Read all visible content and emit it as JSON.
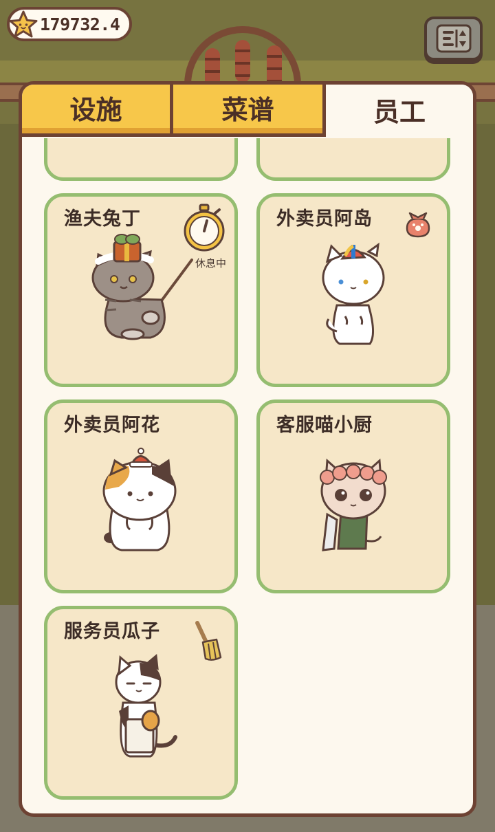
{
  "currency": {
    "value": "179732.4",
    "icon": "star-icon"
  },
  "settings": {
    "icon": "settings-sliders-icon"
  },
  "tabs": [
    {
      "label": "设施",
      "active": false
    },
    {
      "label": "菜谱",
      "active": false
    },
    {
      "label": "员工",
      "active": true
    }
  ],
  "staff": [
    {
      "name": "渔夫兔丁",
      "status": "休息中",
      "status_icon": "stopwatch-icon",
      "character": "tabby-cat-fisher"
    },
    {
      "name": "外卖员阿岛",
      "status_icon": "delivery-bag-icon",
      "character": "white-cat-propeller-cap"
    },
    {
      "name": "外卖员阿花",
      "character": "calico-cat-santa-hat"
    },
    {
      "name": "客服喵小厨",
      "character": "cream-cat-flower-crown"
    },
    {
      "name": "服务员瓜子",
      "status_icon": "broom-icon",
      "character": "bicolor-cat-apron"
    }
  ],
  "colors": {
    "panel_border": "#6d4233",
    "tab_inactive": "#f7c74a",
    "card_bg": "#f6e7c8",
    "card_border": "#95bd70"
  }
}
